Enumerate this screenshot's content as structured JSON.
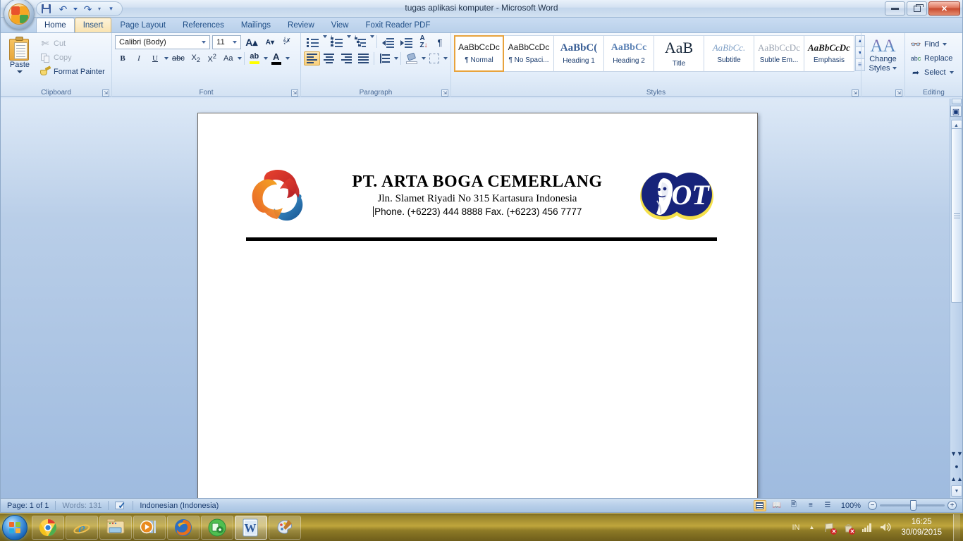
{
  "window": {
    "title": "tugas aplikasi komputer - Microsoft Word",
    "minimize_label": "Minimize",
    "restore_label": "Restore Down",
    "close_label": "Close"
  },
  "quick_access": {
    "office_button": "Office Button",
    "items": [
      {
        "name": "save",
        "icon": "save-icon",
        "label": "Save"
      },
      {
        "name": "undo",
        "icon": "undo-icon",
        "label": "Undo"
      },
      {
        "name": "redo",
        "icon": "redo-icon",
        "label": "Redo"
      },
      {
        "name": "customize",
        "icon": "chevron-down-icon",
        "label": "Customize Quick Access Toolbar"
      }
    ]
  },
  "ribbon": {
    "tabs": [
      {
        "label": "Home",
        "state": "active"
      },
      {
        "label": "Insert",
        "state": "hover"
      },
      {
        "label": "Page Layout",
        "state": "normal"
      },
      {
        "label": "References",
        "state": "normal"
      },
      {
        "label": "Mailings",
        "state": "normal"
      },
      {
        "label": "Review",
        "state": "normal"
      },
      {
        "label": "View",
        "state": "normal"
      },
      {
        "label": "Foxit Reader PDF",
        "state": "normal"
      }
    ],
    "clipboard": {
      "group_label": "Clipboard",
      "paste_label": "Paste",
      "cut_label": "Cut",
      "copy_label": "Copy",
      "format_painter_label": "Format Painter"
    },
    "font": {
      "group_label": "Font",
      "font_family": "Calibri (Body)",
      "font_size": "11",
      "grow_font_label": "A",
      "shrink_font_label": "A",
      "clear_formatting_label": "Aa",
      "bold_label": "B",
      "italic_label": "I",
      "underline_label": "U",
      "strikethrough_label": "abe",
      "subscript_label": "X",
      "superscript_label": "X",
      "change_case_label": "Aa",
      "highlight_label": "ab",
      "font_color_label": "A",
      "highlight_color": "#ffff00",
      "font_color": "#000000"
    },
    "paragraph": {
      "group_label": "Paragraph",
      "bullets_label": "Bullets",
      "numbering_label": "Numbering",
      "multilevel_label": "Multilevel List",
      "decrease_indent_label": "Decrease Indent",
      "increase_indent_label": "Increase Indent",
      "sort_label": "Sort",
      "show_marks_label": "¶",
      "align_left_label": "Align Left",
      "align_center_label": "Center",
      "align_right_label": "Align Right",
      "justify_label": "Justify",
      "line_spacing_label": "Line Spacing",
      "shading_label": "Shading",
      "borders_label": "Borders"
    },
    "styles": {
      "group_label": "Styles",
      "items": [
        {
          "sample": "AaBbCcDc",
          "name": "¶ Normal",
          "selected": true
        },
        {
          "sample": "AaBbCcDc",
          "name": "¶ No Spaci...",
          "selected": false
        },
        {
          "sample": "AaBbC(",
          "name": "Heading 1",
          "selected": false
        },
        {
          "sample": "AaBbCc",
          "name": "Heading 2",
          "selected": false
        },
        {
          "sample": "AaB",
          "name": "Title",
          "selected": false
        },
        {
          "sample": "AaBbCc.",
          "name": "Subtitle",
          "selected": false
        },
        {
          "sample": "AaBbCcDc",
          "name": "Subtle Em...",
          "selected": false
        },
        {
          "sample": "AaBbCcDc",
          "name": "Emphasis",
          "selected": false
        }
      ],
      "scroll_up": "▲",
      "scroll_down": "▼",
      "more": "☰"
    },
    "change_styles": {
      "group_label": "",
      "line1": "Change",
      "line2": "Styles"
    },
    "editing": {
      "group_label": "Editing",
      "find_label": "Find",
      "replace_label": "Replace",
      "select_label": "Select"
    }
  },
  "document": {
    "letterhead": {
      "company_name": "PT. ARTA BOGA CEMERLANG",
      "address": "Jln. Slamet Riyadi No 315 Kartasura Indonesia",
      "contact": "Phone. (+6223) 444 8888  Fax. (+6223) 456 7777",
      "left_logo_name": "arta-boga-swirl-logo",
      "right_logo_name": "orang-tua-ot-logo",
      "right_logo_text": "OT"
    }
  },
  "status_bar": {
    "page": "Page: 1 of 1",
    "words": "Words: 131",
    "language": "Indonesian (Indonesia)",
    "proofing_icon": "proofing-errors-icon",
    "zoom_level": "100%",
    "views": [
      {
        "name": "print-layout",
        "active": true
      },
      {
        "name": "full-screen-reading",
        "active": false
      },
      {
        "name": "web-layout",
        "active": false
      },
      {
        "name": "outline",
        "active": false
      },
      {
        "name": "draft",
        "active": false
      }
    ],
    "zoom_out_label": "−",
    "zoom_in_label": "+"
  },
  "taskbar": {
    "start_label": "Start",
    "apps": [
      {
        "name": "google-chrome",
        "active": false
      },
      {
        "name": "internet-explorer",
        "active": false
      },
      {
        "name": "windows-explorer",
        "active": false
      },
      {
        "name": "windows-media-player",
        "active": false
      },
      {
        "name": "mozilla-firefox",
        "active": false
      },
      {
        "name": "green-sync-app",
        "active": false
      },
      {
        "name": "microsoft-word",
        "active": true
      },
      {
        "name": "paint",
        "active": false
      }
    ],
    "tray": {
      "language": "IN",
      "show_hidden_label": "▲",
      "network_icon": "network-error-icon",
      "action_center_icon": "action-center-error-icon",
      "signal_icon": "signal-bars-icon",
      "volume_icon": "volume-icon",
      "time": "16:25",
      "date": "30/09/2015"
    }
  }
}
